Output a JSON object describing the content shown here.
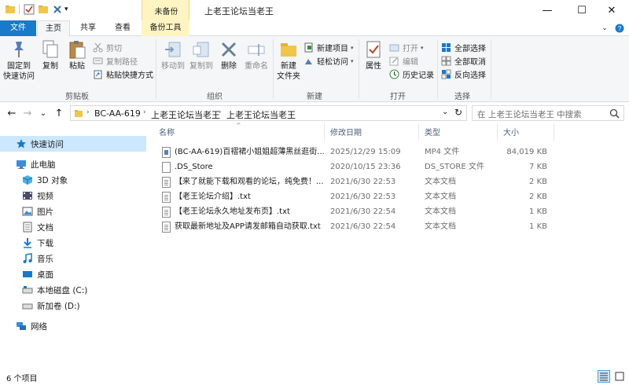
{
  "window": {
    "title": "上老王论坛当老王",
    "tools_band_label": "未备份",
    "controls": {
      "minimize": "—",
      "maximize": "☐",
      "close": "✕"
    }
  },
  "quick_access": [
    "folder-icon",
    "checkmark-properties-icon",
    "new-folder-icon",
    "delete-x-icon",
    "dropdown-arrow-icon"
  ],
  "tabs": {
    "file": "文件",
    "home": "主页",
    "share": "共享",
    "view": "查看",
    "backup_tools": "备份工具"
  },
  "ribbon": {
    "clipboard": {
      "label": "剪贴板",
      "pin": "固定到\n快速访问",
      "copy": "复制",
      "paste": "粘贴",
      "cut": "剪切",
      "copy_path": "复制路径",
      "paste_shortcut": "粘贴快捷方式"
    },
    "organize": {
      "label": "组织",
      "move_to": "移动到",
      "copy_to": "复制到",
      "delete": "删除",
      "rename": "重命名"
    },
    "new": {
      "label": "新建",
      "new_folder": "新建\n文件夹",
      "new_item": "新建项目",
      "easy_access": "轻松访问"
    },
    "open": {
      "label": "打开",
      "properties": "属性",
      "open": "打开",
      "edit": "编辑",
      "history": "历史记录"
    },
    "select": {
      "label": "选择",
      "select_all": "全部选择",
      "select_none": "全部取消",
      "invert": "反向选择"
    }
  },
  "address": {
    "back": "←",
    "forward": "→",
    "recent": "⌄",
    "up": "↑",
    "crumbs": [
      "BC-AA-619",
      "上老王论坛当老王",
      "上老王论坛当老王"
    ],
    "search_placeholder": "在 上老王论坛当老王 中搜索",
    "refresh": "↻",
    "dropdown": "⌄"
  },
  "nav": [
    {
      "label": "快速访问",
      "icon": "star-icon",
      "selected": true
    },
    {
      "label": "此电脑",
      "icon": "computer-icon"
    },
    {
      "label": "3D 对象",
      "icon": "cube-3d-icon"
    },
    {
      "label": "视频",
      "icon": "video-icon"
    },
    {
      "label": "图片",
      "icon": "picture-icon"
    },
    {
      "label": "文档",
      "icon": "document-icon"
    },
    {
      "label": "下载",
      "icon": "download-icon"
    },
    {
      "label": "音乐",
      "icon": "music-icon"
    },
    {
      "label": "桌面",
      "icon": "desktop-icon"
    },
    {
      "label": "本地磁盘 (C:)",
      "icon": "drive-c-icon"
    },
    {
      "label": "新加卷 (D:)",
      "icon": "drive-d-icon"
    },
    {
      "label": "网络",
      "icon": "network-icon"
    }
  ],
  "columns": {
    "name": "名称",
    "modified": "修改日期",
    "type": "类型",
    "size": "大小"
  },
  "files": [
    {
      "name": "(BC-AA-619)百褶裙小姐姐超薄黑丝逛街...",
      "modified": "2025/12/29 15:09",
      "type": "MP4 文件",
      "size": "84,019 KB",
      "icon": "mp4-file-icon"
    },
    {
      "name": ".DS_Store",
      "modified": "2020/10/15 23:36",
      "type": "DS_STORE 文件",
      "size": "7 KB",
      "icon": "blank-file-icon"
    },
    {
      "name": "【来了就能下载和观看的论坛，纯免费！...",
      "modified": "2021/6/30 22:53",
      "type": "文本文档",
      "size": "2 KB",
      "icon": "text-file-icon"
    },
    {
      "name": "【老王论坛介绍】.txt",
      "modified": "2021/6/30 22:53",
      "type": "文本文档",
      "size": "2 KB",
      "icon": "text-file-icon"
    },
    {
      "name": "【老王论坛永久地址发布页】.txt",
      "modified": "2021/6/30 22:54",
      "type": "文本文档",
      "size": "1 KB",
      "icon": "text-file-icon"
    },
    {
      "name": "获取最新地址及APP请发邮箱自动获取.txt",
      "modified": "2021/6/30 22:54",
      "type": "文本文档",
      "size": "1 KB",
      "icon": "text-file-icon"
    }
  ],
  "status": {
    "count": "6 个项目"
  },
  "colors": {
    "accent": "#1979ca",
    "selection": "#cce8ff",
    "tools_band": "#fff4c2"
  }
}
